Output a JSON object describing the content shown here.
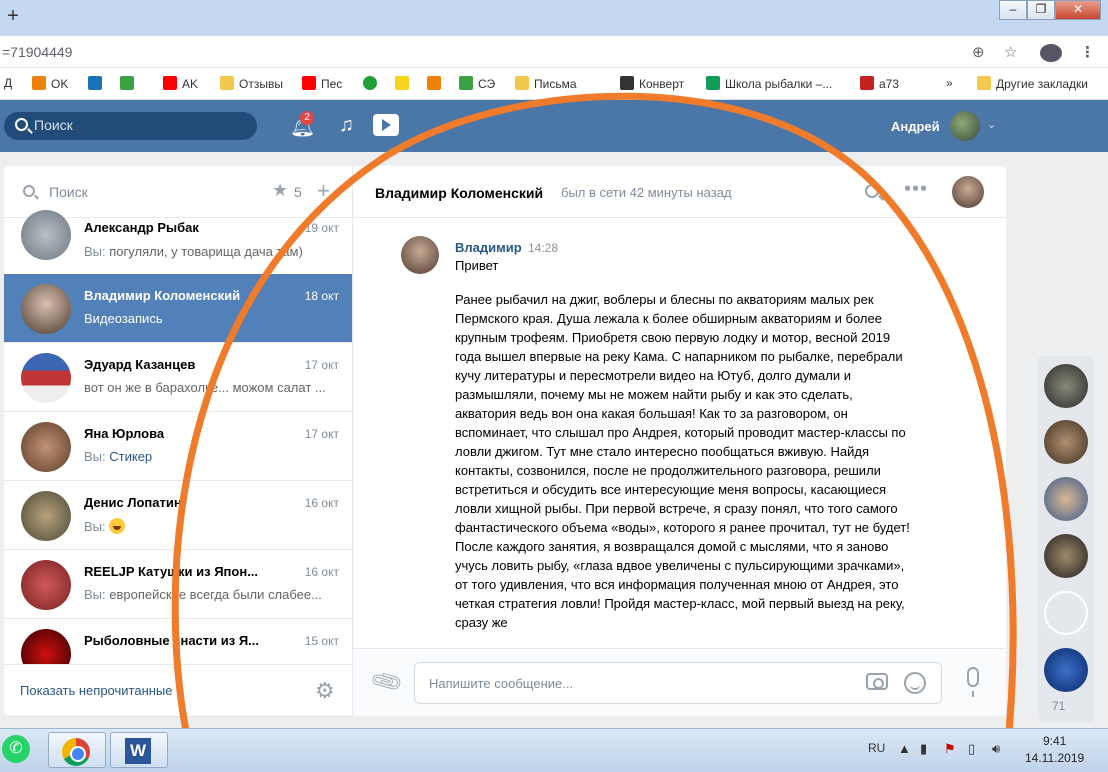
{
  "browser": {
    "new_tab": "+",
    "url_fragment": "=71904449",
    "window_controls": [
      "–",
      "❐",
      "✕"
    ],
    "bookmarks": [
      {
        "label": "Д",
        "color": ""
      },
      {
        "label": "OK",
        "color": "#ee8208"
      },
      {
        "label": "",
        "color": "#1a73b8"
      },
      {
        "label": "",
        "color": "#3aa142"
      },
      {
        "label": "AK",
        "color": "#ff0000"
      },
      {
        "label": "Отзывы",
        "color": "#f2c94c"
      },
      {
        "label": "Пес",
        "color": "#ff0000"
      },
      {
        "label": "",
        "color": "#21a038"
      },
      {
        "label": "",
        "color": "#f7d51d"
      },
      {
        "label": "",
        "color": "#ee8208"
      },
      {
        "label": "СЭ",
        "color": "#3aa142"
      },
      {
        "label": "Письма",
        "color": "#f2c94c"
      },
      {
        "label": "Конверт",
        "color": "#333333"
      },
      {
        "label": "Школа рыбалки –...",
        "color": "#0f9d58"
      },
      {
        "label": "a73",
        "color": "#c5221f"
      },
      {
        "label": "»",
        "color": ""
      },
      {
        "label": "Другие закладки",
        "color": "#f2c94c"
      }
    ]
  },
  "vk": {
    "search_placeholder": "Поиск",
    "notifications_count": "2",
    "user_name": "Андрей"
  },
  "dialogs": {
    "search_placeholder": "Поиск",
    "favorites_count": "5",
    "show_unread": "Показать непрочитанные",
    "items": [
      {
        "name": "Александр Рыбак",
        "date": "19 окт",
        "you": "Вы:",
        "preview": "погуляли, у товарища дача там)",
        "attachment": false,
        "active": false
      },
      {
        "name": "Владимир Коломенский",
        "date": "18 окт",
        "you": "",
        "preview": "Видеозапись",
        "attachment": true,
        "active": true
      },
      {
        "name": "Эдуард Казанцев",
        "date": "17 окт",
        "you": "",
        "preview": "вот он же в барахолке... можом салат ...",
        "attachment": false,
        "active": false
      },
      {
        "name": "Яна Юрлова",
        "date": "17 окт",
        "you": "Вы:",
        "preview": "Стикер",
        "attachment": true,
        "active": false
      },
      {
        "name": "Денис Лопатин",
        "date": "16 окт",
        "you": "Вы:",
        "preview": "",
        "attachment": false,
        "active": false,
        "emoji": "smile"
      },
      {
        "name": "REELJP Катушки из Япон...",
        "date": "16 окт",
        "you": "Вы:",
        "preview": "европейские всегда были слабее...",
        "attachment": false,
        "active": false
      },
      {
        "name": "Рыболовные снасти из Я...",
        "date": "15 окт",
        "you": "",
        "preview": "",
        "attachment": false,
        "active": false
      }
    ]
  },
  "chat": {
    "peer_name": "Владимир Коломенский",
    "peer_status": "был в сети 42 минуты назад",
    "message": {
      "author": "Владимир",
      "time": "14:28",
      "greeting": "Привет",
      "body": "Ранее рыбачил на джиг, воблеры и блесны по акваториям малых рек Пермского края. Душа лежала к более обширным акваториям и более крупным трофеям. Приобретя свою первую лодку и мотор, весной 2019 года вышел впервые на реку Кама. С напарником по рыбалке, перебрали кучу литературы и пересмотрели видео на Ютуб, долго думали и размышляли, почему мы не можем найти рыбу и как это сделать, акватория ведь вон она какая большая! Как то за разговором, он вспоминает, что слышал про Андрея, который проводит мастер-классы по ловли джигом. Тут мне стало интересно пообщаться вживую. Найдя контакты, созвонился, после не продолжительного разговора, решили встретиться и обсудить все интересующие меня вопросы, касающиеся ловли хищной рыбы. При первой встрече, я сразу понял, что того самого фантастического объема «воды», которого я ранее прочитал, тут не будет! После каждого занятия, я возвращался домой с мыслями, что я заново учусь ловить рыбу, «глаза вдвое увеличены с пульсирующими зрачками», от того удивления, что вся информация полученная мною от Андрея, это четкая стратегия ловли! Пройдя мастер-класс, мой первый выезд на реку, сразу же"
    },
    "composer_placeholder": "Напишите сообщение..."
  },
  "rail": {
    "online_count": "71"
  },
  "taskbar": {
    "lang": "RU",
    "time": "9:41",
    "date": "14.11.2019"
  },
  "colors": {
    "vk_blue": "#4a76a8",
    "active_dialog": "#5181b8",
    "annotation": "#f07b2a"
  }
}
